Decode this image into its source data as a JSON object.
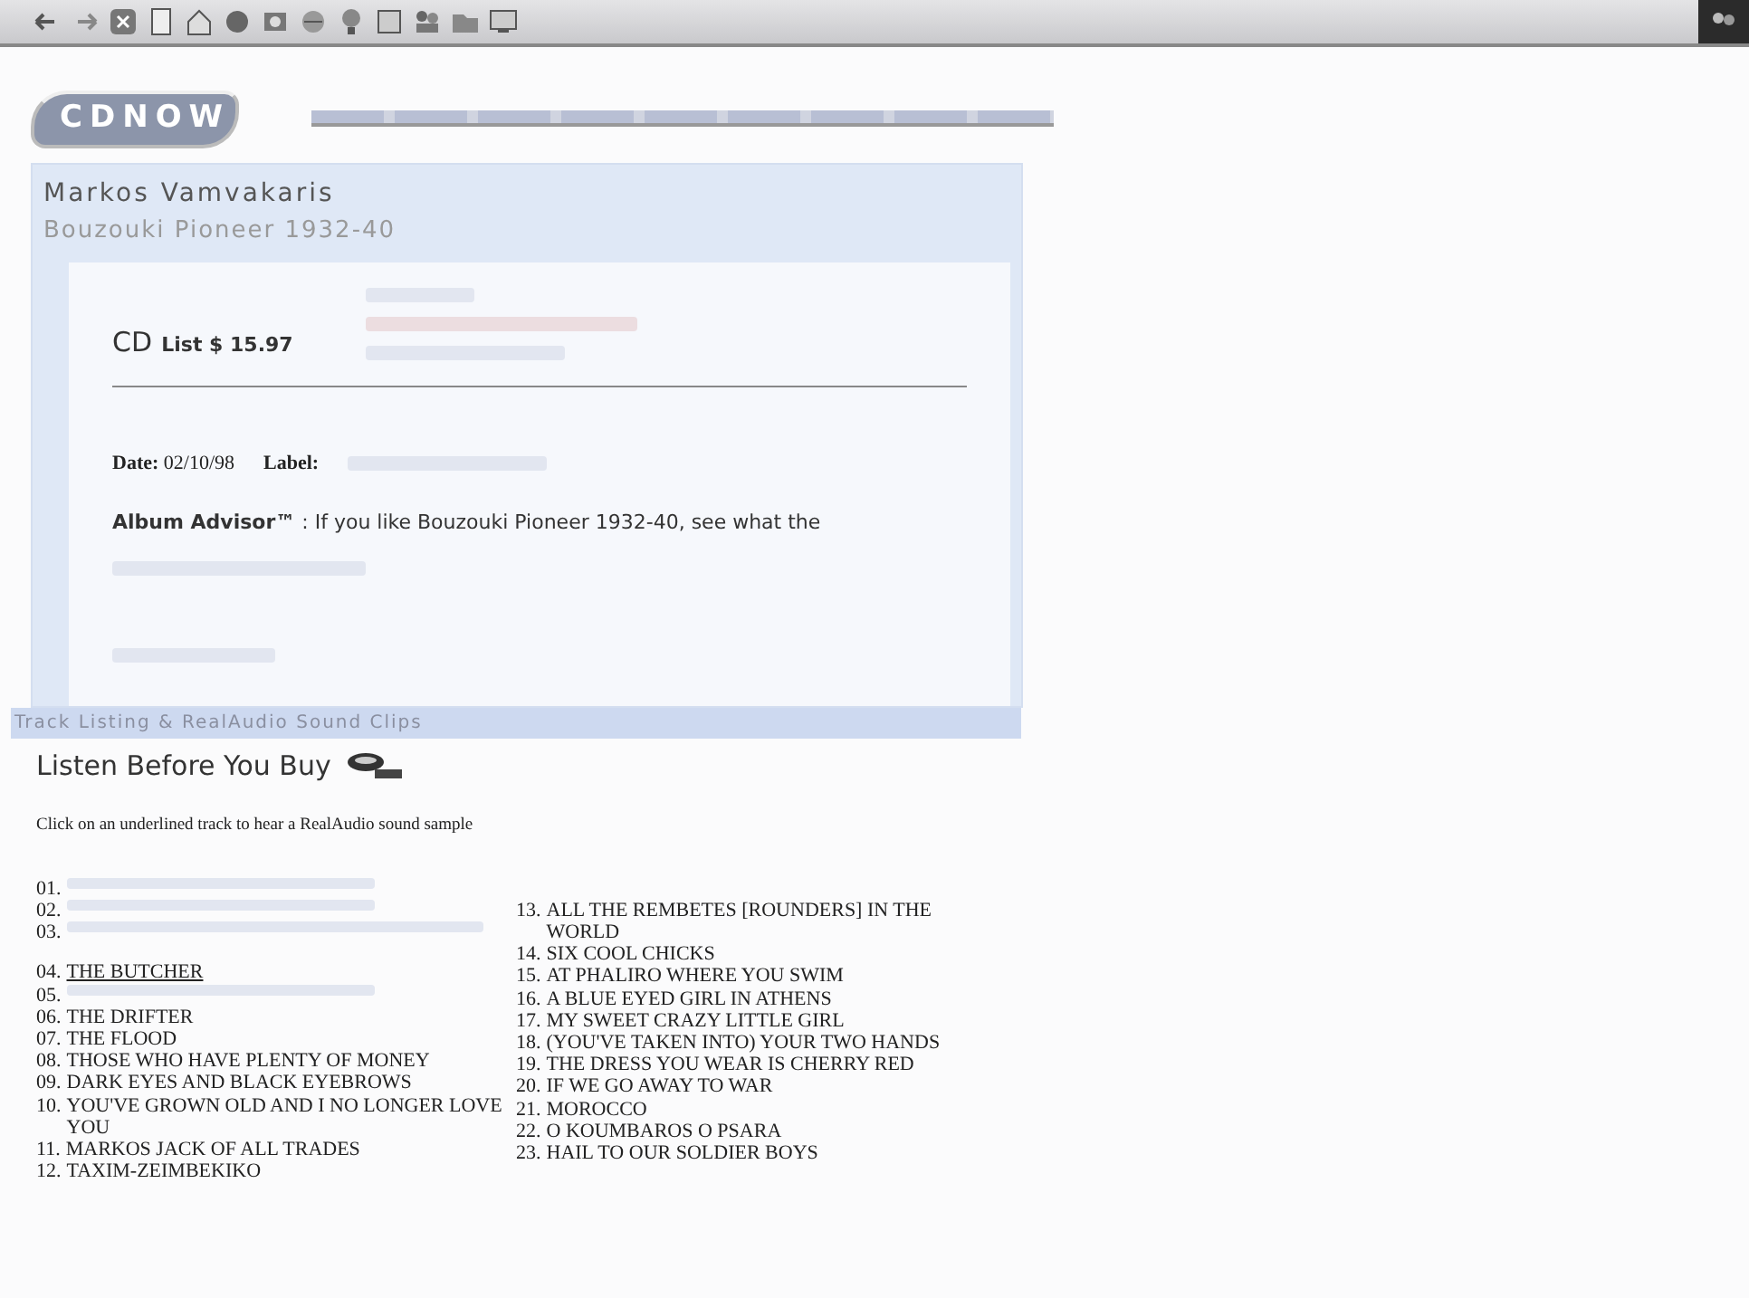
{
  "logo": {
    "text": "CDNOW"
  },
  "album": {
    "artist": "Markos Vamvakaris",
    "title": "Bouzouki Pioneer 1932-40",
    "format": "CD",
    "price": "List $ 15.97",
    "date_label": "Date:",
    "date": "02/10/98",
    "label_label": "Label:",
    "advisor_title": "Album Advisor™",
    "advisor_text": " : If you like Bouzouki Pioneer 1932-40, see what the"
  },
  "strip": {
    "text": "Track Listing & RealAudio Sound Clips"
  },
  "listen": {
    "heading": "Listen Before You Buy",
    "instructions": "Click on an underlined track to hear a RealAudio sound sample"
  },
  "tracks": [
    [
      {
        "number": "01.",
        "kind": "faded"
      },
      {
        "number": "02.",
        "kind": "faded"
      },
      {
        "number": "03.",
        "kind": "faded_long"
      },
      {
        "number": "04.",
        "title": "THE BUTCHER",
        "kind": "link"
      },
      {
        "number": "05.",
        "kind": "faded"
      },
      {
        "number": "06.",
        "title": "THE DRIFTER",
        "kind": "plain"
      },
      {
        "number": "07.",
        "title": "THE FLOOD",
        "kind": "plain"
      },
      {
        "number": "08.",
        "title": "THOSE WHO HAVE PLENTY OF MONEY",
        "kind": "plain"
      },
      {
        "number": "09.",
        "title": "DARK EYES AND BLACK EYEBROWS",
        "kind": "plain"
      },
      {
        "number": "10.",
        "title": "YOU'VE GROWN OLD AND I NO LONGER LOVE YOU",
        "kind": "plain"
      },
      {
        "number": "11.",
        "title": "MARKOS JACK OF ALL TRADES",
        "kind": "plain"
      },
      {
        "number": "12.",
        "title": "TAXIM-ZEIMBEKIKO",
        "kind": "plain"
      }
    ],
    [
      {
        "number": "13.",
        "title": "ALL THE REMBETES [ROUNDERS] IN THE WORLD",
        "kind": "plain"
      },
      {
        "number": "14.",
        "title": "SIX COOL CHICKS",
        "kind": "plain"
      },
      {
        "number": "15.",
        "title": "AT PHALIRO WHERE YOU SWIM",
        "kind": "plain"
      },
      {
        "number": "16.",
        "title": "A BLUE EYED GIRL IN ATHENS",
        "kind": "plain"
      },
      {
        "number": "17.",
        "title": "MY SWEET CRAZY LITTLE GIRL",
        "kind": "plain"
      },
      {
        "number": "18.",
        "title": "(YOU'VE TAKEN INTO) YOUR TWO HANDS",
        "kind": "plain"
      },
      {
        "number": "19.",
        "title": "THE DRESS YOU WEAR IS CHERRY RED",
        "kind": "plain"
      },
      {
        "number": "20.",
        "title": "IF WE GO AWAY TO WAR",
        "kind": "plain"
      },
      {
        "number": "21.",
        "title": "MOROCCO",
        "kind": "plain"
      },
      {
        "number": "22.",
        "title": "O KOUMBAROS O PSARA",
        "kind": "plain"
      },
      {
        "number": "23.",
        "title": "HAIL TO OUR SOLDIER BOYS",
        "kind": "plain"
      }
    ]
  ]
}
